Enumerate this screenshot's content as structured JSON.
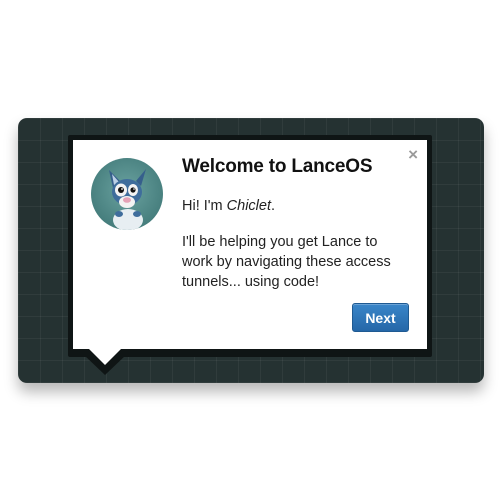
{
  "dialog": {
    "title": "Welcome to LanceOS",
    "greeting_prefix": "Hi! I'm ",
    "greeting_name": "Chiclet",
    "greeting_suffix": ".",
    "message": "I'll be helping you get Lance to work by navigating these access tunnels... using code!",
    "next_label": "Next",
    "close_glyph": "×"
  },
  "icons": {
    "avatar": "chiclet-avatar-icon",
    "close": "close-icon"
  },
  "colors": {
    "stage_background": "#253232",
    "dialog_frame": "#0f1515",
    "button_blue": "#2d74b8"
  }
}
